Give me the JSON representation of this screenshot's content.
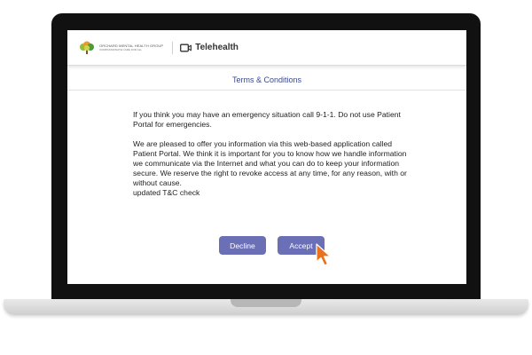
{
  "app": {
    "logo_name": "ORCHARD MENTAL HEALTH GROUP",
    "logo_tagline": "COMPASSIONATE CARE FOR ALL",
    "title": "Telehealth",
    "title_icon": "video-camera-icon"
  },
  "terms": {
    "heading": "Terms & Conditions",
    "paragraphs": [
      "If you think you may have an emergency situation call 9-1-1. Do not use Patient Portal for emergencies.",
      "We are pleased to offer you information via this web-based application called Patient Portal. We think it is important for you to know how we handle information we communicate via the Internet and what you can do to keep your information secure. We reserve the right to revoke access at any time, for any reason, with or without cause."
    ],
    "note": "updated T&C check"
  },
  "actions": {
    "decline_label": "Decline",
    "accept_label": "Accept"
  },
  "colors": {
    "button": "#6b6fb5",
    "heading": "#3c4b8c",
    "cursor": "#e8731c"
  }
}
